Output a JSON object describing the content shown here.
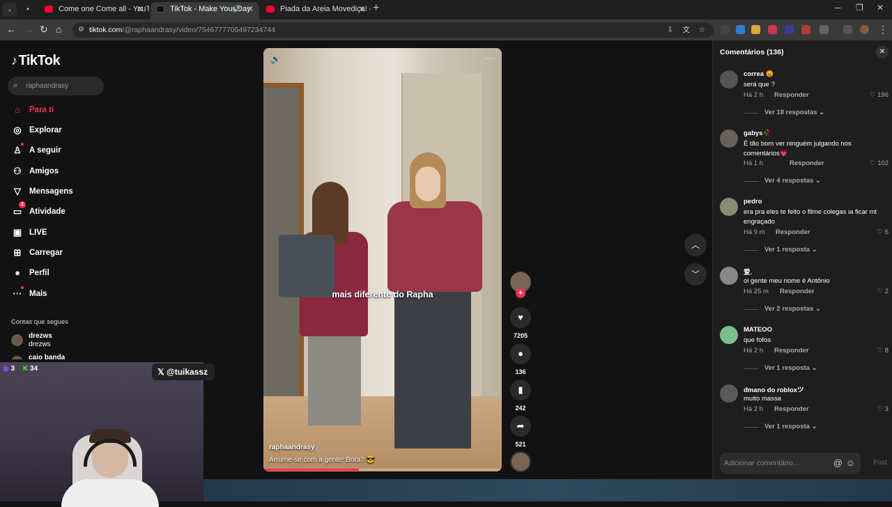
{
  "browser": {
    "tabs": [
      {
        "title": "Come one Come all - YouTube"
      },
      {
        "title": "TikTok - Make Your Day"
      },
      {
        "title": "Piada da Areia Movediça! - You"
      }
    ],
    "url_host": "tiktok.com",
    "url_path": "/@raphaandrasy/video/7546777705497234744"
  },
  "sidebar": {
    "logo": "TikTok",
    "search_placeholder": "raphaandrasy",
    "items": [
      {
        "label": "Para ti"
      },
      {
        "label": "Explorar"
      },
      {
        "label": "A seguir"
      },
      {
        "label": "Amigos"
      },
      {
        "label": "Mensagens"
      },
      {
        "label": "Atividade",
        "badge": "2"
      },
      {
        "label": "LIVE"
      },
      {
        "label": "Carregar"
      },
      {
        "label": "Perfil"
      },
      {
        "label": "Mais"
      }
    ],
    "following_title": "Contas que segues",
    "following": [
      {
        "name": "drezws",
        "handle": "drezws"
      },
      {
        "name": "caio banda"
      }
    ]
  },
  "video": {
    "caption": "mais diferente do Rapha",
    "author": "raphaandrasy",
    "description": "Arrume-se com a gente! Bora? 😎"
  },
  "actions": {
    "likes": "7205",
    "comments": "136",
    "saves": "242",
    "shares": "521"
  },
  "comments_panel": {
    "title": "Comentários (136)",
    "items": [
      {
        "user": "correa 😡",
        "text": "será que ?",
        "time": "Há 2 h",
        "reply": "Responder",
        "likes": "196",
        "more": "Ver 18 respostas ⌄"
      },
      {
        "user": "gabys🥀",
        "text": "É tão bom ver ninguém julgando nos comentários💗",
        "time": "Há 1 h",
        "reply": "Responder",
        "likes": "102",
        "more": "Ver 4 respostas ⌄"
      },
      {
        "user": "pedro",
        "text": "era pra eles te feito o filme colegas ia ficar mt engraçado",
        "time": "Há 9 m",
        "reply": "Responder",
        "likes": "6",
        "more": "Ver 1 resposta ⌄"
      },
      {
        "user": "爱.",
        "text": "oi gente meu nome é Antônio",
        "time": "Há 25 m",
        "reply": "Responder",
        "likes": "2",
        "more": "Ver 2 respostas ⌄"
      },
      {
        "user": "MATEOO",
        "text": "que fofos",
        "time": "Há 2 h",
        "reply": "Responder",
        "likes": "8",
        "more": "Ver 1 resposta ⌄"
      },
      {
        "user": "ᵭmano do robloxツ",
        "text": "muito massa",
        "time": "Há 2 h",
        "reply": "Responder",
        "likes": "3",
        "more": "Ver 1 resposta ⌄"
      }
    ],
    "input_placeholder": "Adicionar comentário...",
    "post_label": "Post"
  },
  "stream": {
    "viewers": "3",
    "kick_count": "34",
    "x_handle": "@tuikassz"
  }
}
